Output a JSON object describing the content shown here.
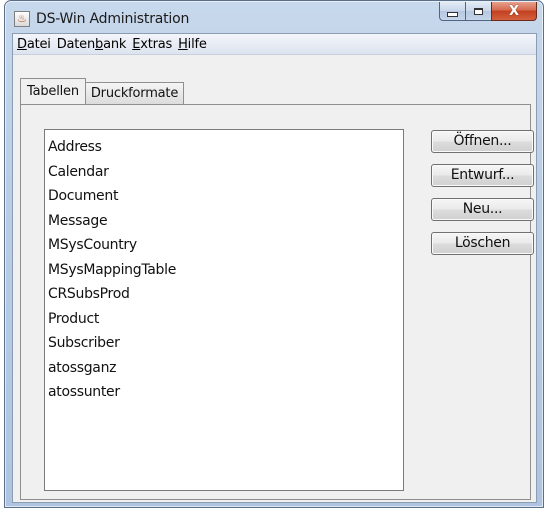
{
  "window": {
    "title": "DS-Win Administration",
    "icon": "java-cup-icon",
    "controls": {
      "minimize": "minimize-icon",
      "maximize": "maximize-icon",
      "close": "X"
    }
  },
  "menubar": {
    "items": [
      {
        "label": "Datei",
        "mnemonic": "D",
        "rest": "atei"
      },
      {
        "label": "Datenbank",
        "before": "Daten",
        "mnemonic": "b",
        "rest": "ank"
      },
      {
        "label": "Extras",
        "mnemonic": "E",
        "rest": "xtras"
      },
      {
        "label": "Hilfe",
        "mnemonic": "H",
        "rest": "ilfe"
      }
    ]
  },
  "tabs": [
    {
      "label": "Tabellen",
      "selected": true
    },
    {
      "label": "Druckformate",
      "selected": false
    }
  ],
  "tables": [
    "Address",
    "Calendar",
    "Document",
    "Message",
    "MSysCountry",
    "MSysMappingTable",
    "CRSubsProd",
    "Product",
    "Subscriber",
    "atossganz",
    "atossunter"
  ],
  "buttons": {
    "open": "Öffnen...",
    "design": "Entwurf...",
    "new": "Neu...",
    "delete": "Löschen"
  },
  "colors": {
    "client_bg": "#f0f0f0",
    "list_bg": "#ffffff",
    "close_button": "#c3401f"
  }
}
